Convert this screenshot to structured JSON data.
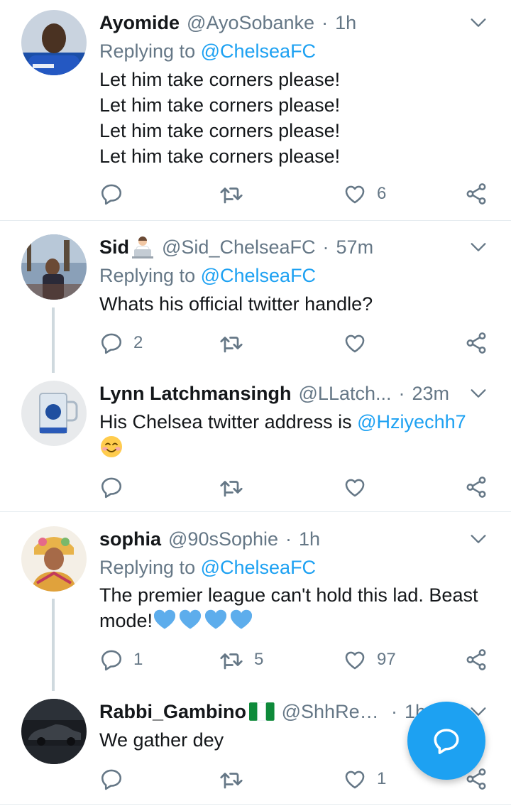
{
  "tweets": [
    {
      "name": "Ayomide",
      "handle": "@AyoSobanke",
      "time": "1h",
      "replying_prefix": "Replying to ",
      "replying_to": "@ChelseaFC",
      "lines": [
        "Let him take corners please!",
        "Let him take corners please!",
        "Let him take corners please!",
        "Let him take corners please!"
      ],
      "reply_count": "",
      "retweet_count": "",
      "like_count": "6"
    },
    {
      "name": "Sid",
      "handle": "@Sid_ChelseaFC",
      "time": "57m",
      "replying_prefix": "Replying to ",
      "replying_to": "@ChelseaFC",
      "text": "Whats his official twitter handle?",
      "reply_count": "2",
      "retweet_count": "",
      "like_count": ""
    },
    {
      "name": "Lynn Latchmansingh",
      "handle": "@LLatch...",
      "time": "23m",
      "text_prefix": "His Chelsea twitter address is ",
      "text_mention": "@Hziyechh7",
      "reply_count": "",
      "retweet_count": "",
      "like_count": ""
    },
    {
      "name": "sophia",
      "handle": "@90sSophie",
      "time": "1h",
      "replying_prefix": "Replying to ",
      "replying_to": "@ChelseaFC",
      "text_line1": "The premier league can't hold this lad. Beast",
      "text_line2": "mode!",
      "reply_count": "1",
      "retweet_count": "5",
      "like_count": "97"
    },
    {
      "name": "Rabbi_Gambino",
      "handle": "@ShhRebel",
      "time": "1h",
      "text": "We gather dey",
      "reply_count": "",
      "retweet_count": "",
      "like_count": "1"
    }
  ],
  "dot": "·",
  "colors": {
    "link": "#1da1f2",
    "secondary": "#657786",
    "divider": "#e6ecf0",
    "fab": "#1da1f2"
  },
  "icons": [
    "reply-icon",
    "retweet-icon",
    "like-icon",
    "share-icon",
    "chevron-down-icon",
    "compose-icon"
  ]
}
